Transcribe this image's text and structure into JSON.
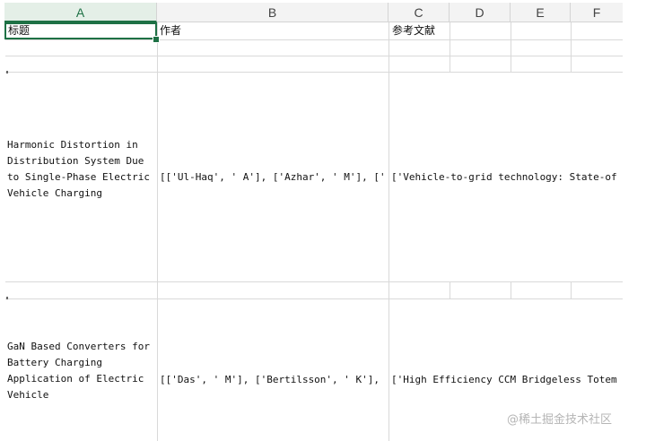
{
  "columns": [
    "A",
    "B",
    "C",
    "D",
    "E",
    "F"
  ],
  "header_row": {
    "title": "标题",
    "authors": "作者",
    "references": "参考文献"
  },
  "rows": [
    {
      "title": "Harmonic Distortion in Distribution System Due to Single-Phase Electric Vehicle Charging",
      "authors": "[['Ul-Haq', ' A'], ['Azhar', ' M'], ['",
      "references": "['Vehicle-to-grid technology: State-of"
    },
    {
      "title": "GaN Based Converters for Battery Charging Application of Electric Vehicle",
      "authors": "[['Das', ' M'], ['Bertilsson', ' K'],",
      "references": "['High Efficiency CCM Bridgeless Totem"
    }
  ],
  "watermark": "@稀土掘金技术社区",
  "colors": {
    "accent": "#1e7145",
    "grid": "#d9d9d9",
    "header_bg": "#f3f3f3"
  }
}
